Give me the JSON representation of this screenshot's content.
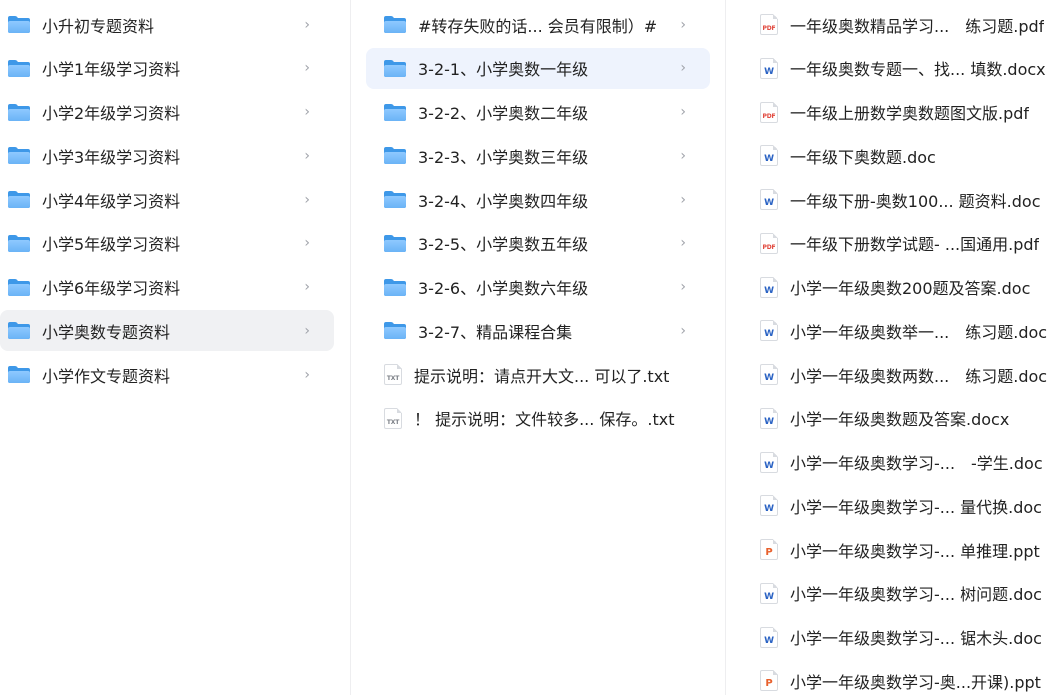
{
  "columns": {
    "left": {
      "items": [
        {
          "label": "小升初专题资料",
          "icon": "folder-icon"
        },
        {
          "label": "小学1年级学习资料",
          "icon": "folder-icon"
        },
        {
          "label": "小学2年级学习资料",
          "icon": "folder-icon"
        },
        {
          "label": "小学3年级学习资料",
          "icon": "folder-icon"
        },
        {
          "label": "小学4年级学习资料",
          "icon": "folder-icon"
        },
        {
          "label": "小学5年级学习资料",
          "icon": "folder-icon"
        },
        {
          "label": "小学6年级学习资料",
          "icon": "folder-icon"
        },
        {
          "label": "小学奥数专题资料",
          "icon": "folder-icon",
          "selected": true
        },
        {
          "label": "小学作文专题资料",
          "icon": "folder-icon"
        }
      ]
    },
    "middle": {
      "items": [
        {
          "label": "#转存失败的话... 会员有限制）#",
          "icon": "folder-icon"
        },
        {
          "label": "3-2-1、小学奥数一年级",
          "icon": "folder-icon",
          "selected": true
        },
        {
          "label": "3-2-2、小学奥数二年级",
          "icon": "folder-icon"
        },
        {
          "label": "3-2-3、小学奥数三年级",
          "icon": "folder-icon"
        },
        {
          "label": "3-2-4、小学奥数四年级",
          "icon": "folder-icon"
        },
        {
          "label": "3-2-5、小学奥数五年级",
          "icon": "folder-icon"
        },
        {
          "label": "3-2-6、小学奥数六年级",
          "icon": "folder-icon"
        },
        {
          "label": "3-2-7、精品课程合集",
          "icon": "folder-icon"
        },
        {
          "label": "提示说明：请点开大文... 可以了.txt",
          "icon": "txt-file-icon"
        },
        {
          "label": "！ 提示说明：文件较多... 保存。.txt",
          "icon": "txt-file-icon"
        }
      ]
    },
    "right": {
      "items": [
        {
          "label": "一年级奥数精品学习...　练习题.pdf",
          "icon": "pdf-file-icon"
        },
        {
          "label": "一年级奥数专题一、找... 填数.docx",
          "icon": "word-file-icon"
        },
        {
          "label": "一年级上册数学奥数题图文版.pdf",
          "icon": "pdf-file-icon"
        },
        {
          "label": "一年级下奥数题.doc",
          "icon": "word-file-icon"
        },
        {
          "label": "一年级下册-奥数100... 题资料.doc",
          "icon": "word-file-icon"
        },
        {
          "label": "一年级下册数学试题- ...国通用.pdf",
          "icon": "pdf-file-icon"
        },
        {
          "label": "小学一年级奥数200题及答案.doc",
          "icon": "word-file-icon"
        },
        {
          "label": "小学一年级奥数举一...　练习题.doc",
          "icon": "word-file-icon"
        },
        {
          "label": "小学一年级奥数两数...　练习题.doc",
          "icon": "word-file-icon"
        },
        {
          "label": "小学一年级奥数题及答案.docx",
          "icon": "word-file-icon"
        },
        {
          "label": "小学一年级奥数学习-...　-学生.doc",
          "icon": "word-file-icon"
        },
        {
          "label": "小学一年级奥数学习-... 量代换.doc",
          "icon": "word-file-icon"
        },
        {
          "label": "小学一年级奥数学习-... 单推理.ppt",
          "icon": "ppt-file-icon"
        },
        {
          "label": "小学一年级奥数学习-... 树问题.doc",
          "icon": "word-file-icon"
        },
        {
          "label": "小学一年级奥数学习-... 锯木头.doc",
          "icon": "word-file-icon"
        },
        {
          "label": "小学一年级奥数学习-奥...开课).ppt",
          "icon": "ppt-file-icon"
        }
      ]
    }
  },
  "chevron": "›",
  "file_tags": {
    "pdf": "PDF",
    "txt": "TXT",
    "word": "W",
    "ppt": "P"
  },
  "colors": {
    "folder_back": "#3e98e8",
    "folder_front": "#8ec9ff",
    "selected_left_bg": "#f0f1f3",
    "selected_middle_bg": "#eef3fd",
    "pdf": "#e0453b",
    "word": "#2b63c4",
    "ppt": "#e8602c"
  }
}
